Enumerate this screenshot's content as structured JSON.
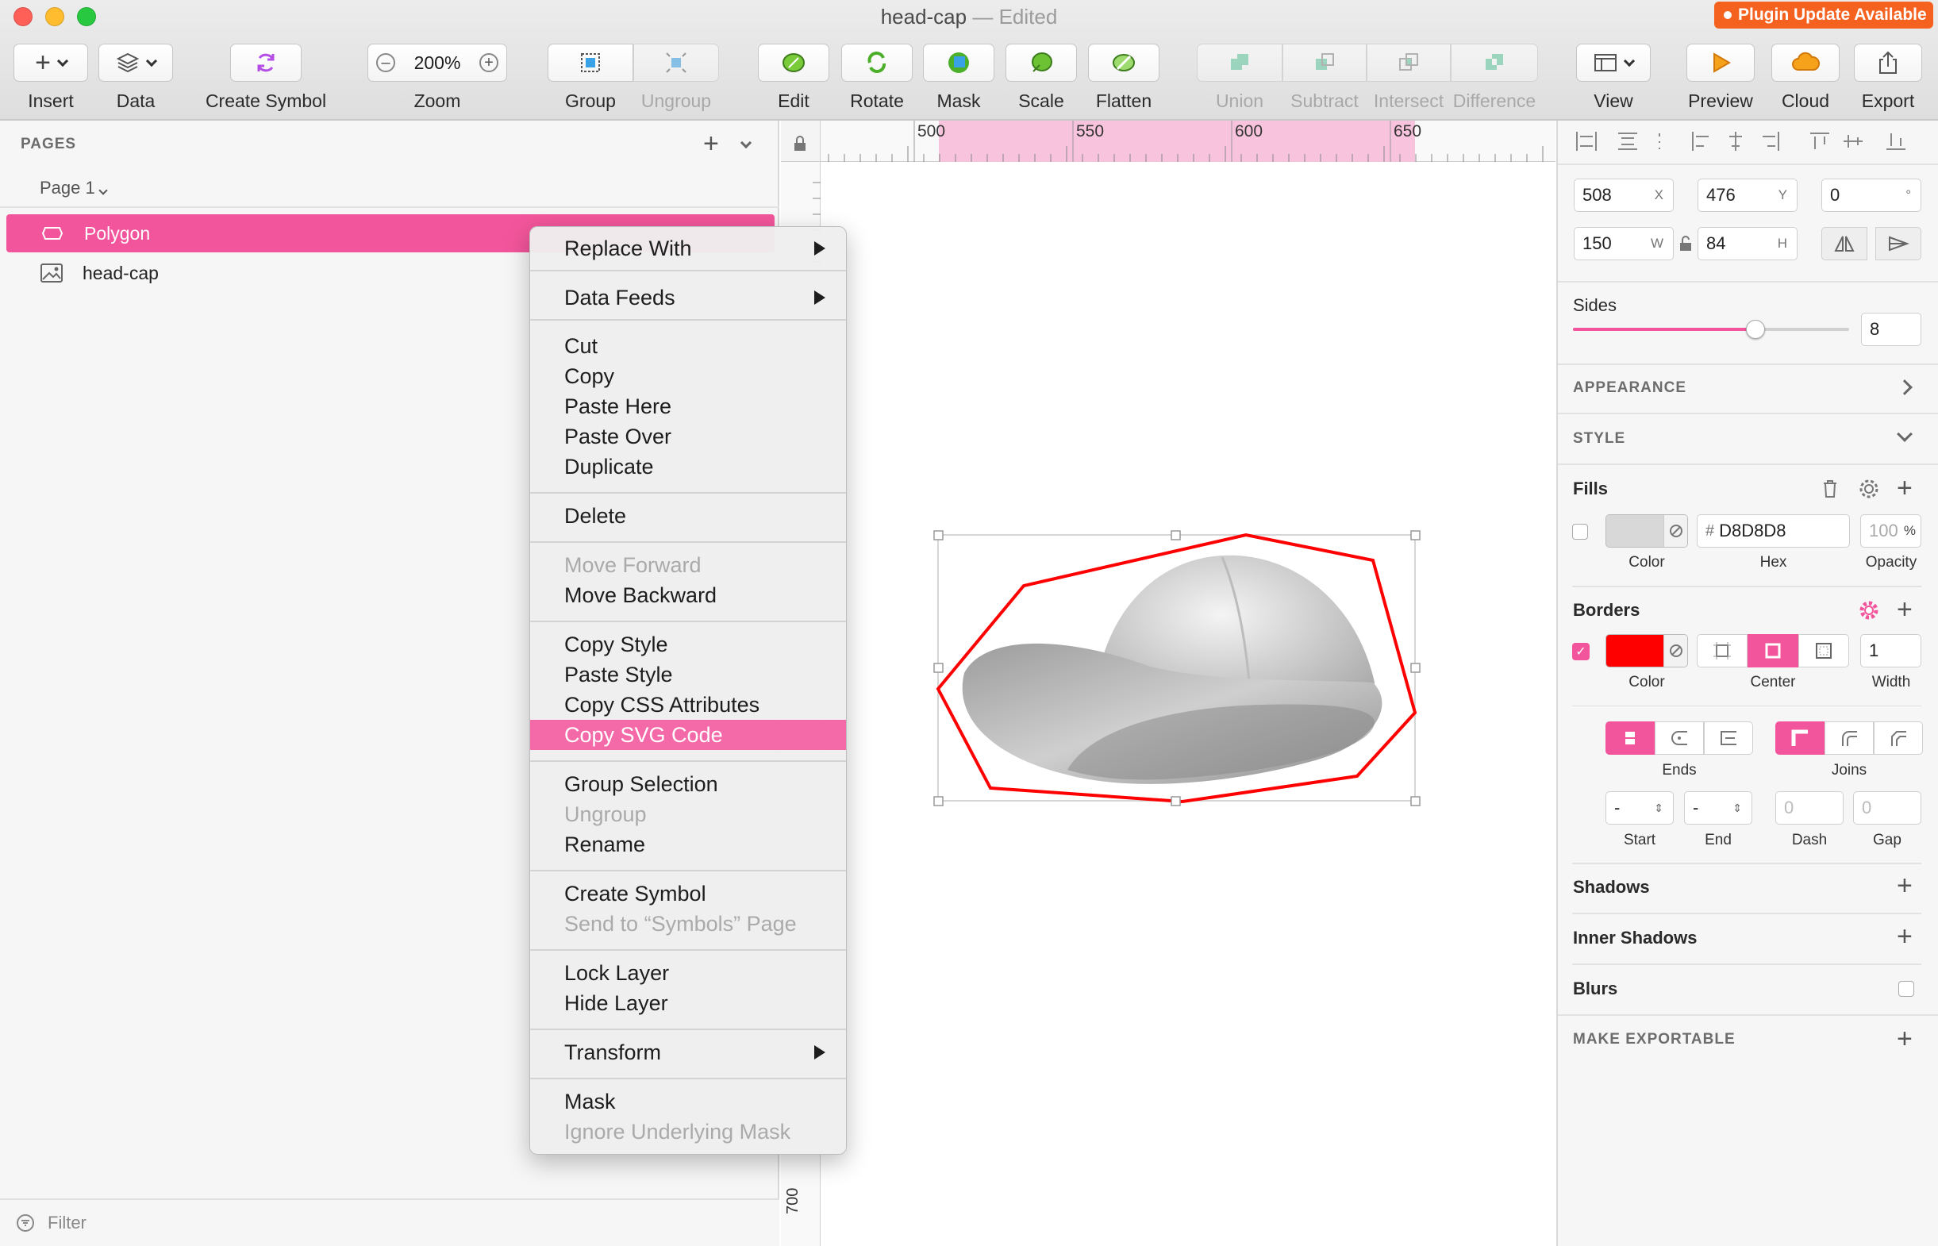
{
  "window": {
    "title": "head-cap",
    "edited": "— Edited"
  },
  "plugin_badge": "Plugin Update Available",
  "toolbar": {
    "insert": "Insert",
    "data": "Data",
    "create_symbol": "Create Symbol",
    "zoom": "Zoom",
    "zoom_value": "200%",
    "group": "Group",
    "ungroup": "Ungroup",
    "edit": "Edit",
    "rotate": "Rotate",
    "mask": "Mask",
    "scale": "Scale",
    "flatten": "Flatten",
    "union": "Union",
    "subtract": "Subtract",
    "intersect": "Intersect",
    "difference": "Difference",
    "view": "View",
    "preview": "Preview",
    "cloud": "Cloud",
    "export": "Export"
  },
  "sidebar": {
    "pages_label": "PAGES",
    "current_page": "Page 1",
    "layers": [
      {
        "name": "Polygon",
        "selected": true,
        "icon": "polygon-icon"
      },
      {
        "name": "head-cap",
        "selected": false,
        "icon": "image-icon"
      }
    ],
    "filter_placeholder": "Filter"
  },
  "rulers": {
    "top": [
      "500",
      "550",
      "600",
      "650"
    ],
    "left": [
      "700"
    ]
  },
  "context_menu": {
    "replace_with": "Replace With",
    "data_feeds": "Data Feeds",
    "cut": "Cut",
    "copy": "Copy",
    "paste_here": "Paste Here",
    "paste_over": "Paste Over",
    "duplicate": "Duplicate",
    "delete": "Delete",
    "move_forward": "Move Forward",
    "move_backward": "Move Backward",
    "copy_style": "Copy Style",
    "paste_style": "Paste Style",
    "copy_css": "Copy CSS Attributes",
    "copy_svg": "Copy SVG Code",
    "group_selection": "Group Selection",
    "ungroup": "Ungroup",
    "rename": "Rename",
    "create_symbol": "Create Symbol",
    "send_to_symbols": "Send to “Symbols” Page",
    "lock_layer": "Lock Layer",
    "hide_layer": "Hide Layer",
    "transform": "Transform",
    "mask": "Mask",
    "ignore_mask": "Ignore Underlying Mask"
  },
  "inspector": {
    "x": "508",
    "x_unit": "X",
    "y": "476",
    "y_unit": "Y",
    "rotation": "0",
    "rotation_unit": "°",
    "w": "150",
    "w_unit": "W",
    "h": "84",
    "h_unit": "H",
    "sides_label": "Sides",
    "sides_value": "8",
    "sides_fraction": 0.66,
    "appearance": "APPEARANCE",
    "style": "STYLE",
    "fills": {
      "title": "Fills",
      "hex_prefix": "#",
      "hex": "D8D8D8",
      "opacity": "100",
      "opacity_unit": "%",
      "color_label": "Color",
      "hex_label": "Hex",
      "opacity_label": "Opacity",
      "swatch": "#D8D8D8"
    },
    "borders": {
      "title": "Borders",
      "swatch": "#FF0000",
      "width": "1",
      "color_label": "Color",
      "position_label": "Center",
      "width_label": "Width"
    },
    "ends_label": "Ends",
    "joins_label": "Joins",
    "start_value": "-",
    "end_value": "-",
    "dash_placeholder": "0",
    "gap_placeholder": "0",
    "start_label": "Start",
    "end_label": "End",
    "dash_label": "Dash",
    "gap_label": "Gap",
    "shadows": "Shadows",
    "inner_shadows": "Inner Shadows",
    "blurs": "Blurs",
    "make_exportable": "MAKE EXPORTABLE"
  },
  "colors": {
    "accent": "#F2559B",
    "selection_border": "#FF0000",
    "plugin_badge": "#F5621F"
  }
}
